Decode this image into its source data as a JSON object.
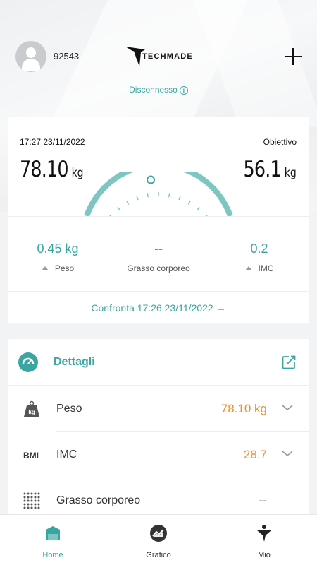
{
  "header": {
    "user_id": "92543",
    "brand": "TECHMADE",
    "status": "Disconnesso",
    "info_glyph": "i"
  },
  "measurement": {
    "datetime": "17:27 23/11/2022",
    "goal_label": "Obiettivo",
    "weight_value": "78.10",
    "weight_unit": "kg",
    "goal_value": "56.1",
    "goal_unit": "kg",
    "gauge_progress_fraction": 0.45
  },
  "stats": [
    {
      "value": "0.45 kg",
      "label": "Peso",
      "trend": "up"
    },
    {
      "value": "--",
      "label": "Grasso corporeo",
      "trend": "none"
    },
    {
      "value": "0.2",
      "label": "IMC",
      "trend": "up"
    }
  ],
  "compare": {
    "label": "Confronta 17:26 23/11/2022",
    "arrow": "→"
  },
  "details": {
    "title": "Dettagli",
    "rows": [
      {
        "icon": "weight-kg-icon",
        "icon_text": "kg",
        "label": "Peso",
        "value": "78.10 kg",
        "expandable": true
      },
      {
        "icon": "bmi-icon",
        "icon_text": "BMI",
        "label": "IMC",
        "value": "28.7",
        "expandable": true
      },
      {
        "icon": "body-fat-icon",
        "label": "Grasso corporeo",
        "value": "--",
        "expandable": false
      }
    ]
  },
  "nav": [
    {
      "label": "Home",
      "icon": "home-icon",
      "active": true
    },
    {
      "label": "Grafico",
      "icon": "chart-icon",
      "active": false
    },
    {
      "label": "Mio",
      "icon": "profile-icon",
      "active": false
    }
  ],
  "colors": {
    "accent": "#3aa6a1",
    "value_orange": "#f0902a",
    "gauge_track": "#7ec6c2"
  }
}
